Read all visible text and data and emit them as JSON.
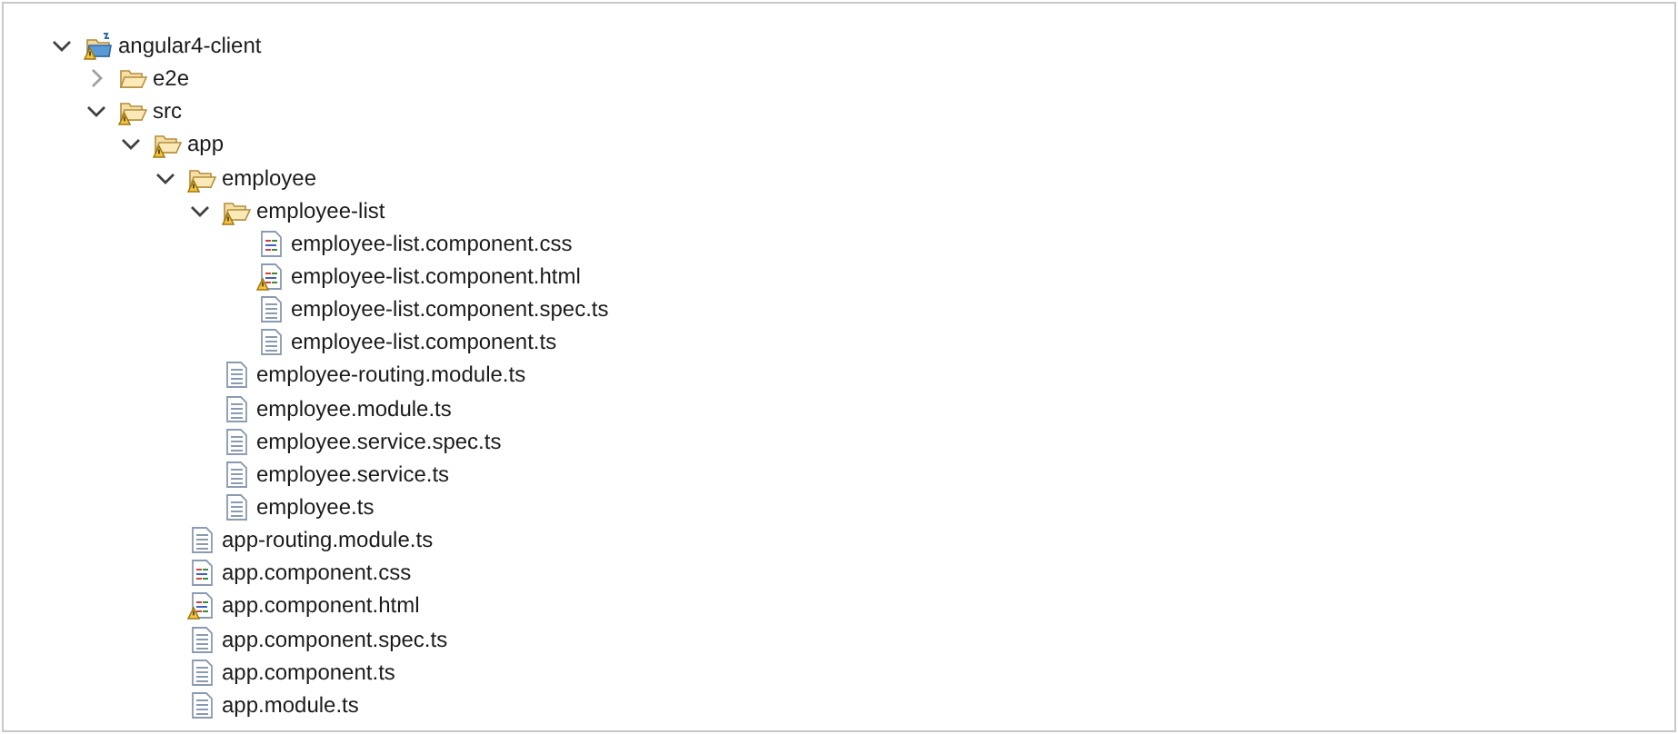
{
  "tree": [
    {
      "label": "angular4-client",
      "kind": "project",
      "warning": true,
      "expanded": true,
      "children": [
        {
          "label": "e2e",
          "kind": "folder",
          "warning": false,
          "expanded": false
        },
        {
          "label": "src",
          "kind": "folder",
          "warning": true,
          "expanded": true,
          "children": [
            {
              "label": "app",
              "kind": "folder",
              "warning": true,
              "expanded": true,
              "children": [
                {
                  "label": "employee",
                  "kind": "folder",
                  "warning": true,
                  "expanded": true,
                  "children": [
                    {
                      "label": "employee-list",
                      "kind": "folder",
                      "warning": true,
                      "expanded": true,
                      "children": [
                        {
                          "label": "employee-list.component.css",
                          "kind": "markup",
                          "warning": false
                        },
                        {
                          "label": "employee-list.component.html",
                          "kind": "markup",
                          "warning": true
                        },
                        {
                          "label": "employee-list.component.spec.ts",
                          "kind": "text",
                          "warning": false
                        },
                        {
                          "label": "employee-list.component.ts",
                          "kind": "text",
                          "warning": false
                        }
                      ]
                    },
                    {
                      "label": "employee-routing.module.ts",
                      "kind": "text",
                      "warning": false
                    },
                    {
                      "label": "employee.module.ts",
                      "kind": "text",
                      "warning": false
                    },
                    {
                      "label": "employee.service.spec.ts",
                      "kind": "text",
                      "warning": false
                    },
                    {
                      "label": "employee.service.ts",
                      "kind": "text",
                      "warning": false
                    },
                    {
                      "label": "employee.ts",
                      "kind": "text",
                      "warning": false
                    }
                  ]
                },
                {
                  "label": "app-routing.module.ts",
                  "kind": "text",
                  "warning": false
                },
                {
                  "label": "app.component.css",
                  "kind": "markup",
                  "warning": false
                },
                {
                  "label": "app.component.html",
                  "kind": "markup",
                  "warning": true
                },
                {
                  "label": "app.component.spec.ts",
                  "kind": "text",
                  "warning": false
                },
                {
                  "label": "app.component.ts",
                  "kind": "text",
                  "warning": false
                },
                {
                  "label": "app.module.ts",
                  "kind": "text",
                  "warning": false
                }
              ]
            }
          ]
        }
      ]
    }
  ]
}
